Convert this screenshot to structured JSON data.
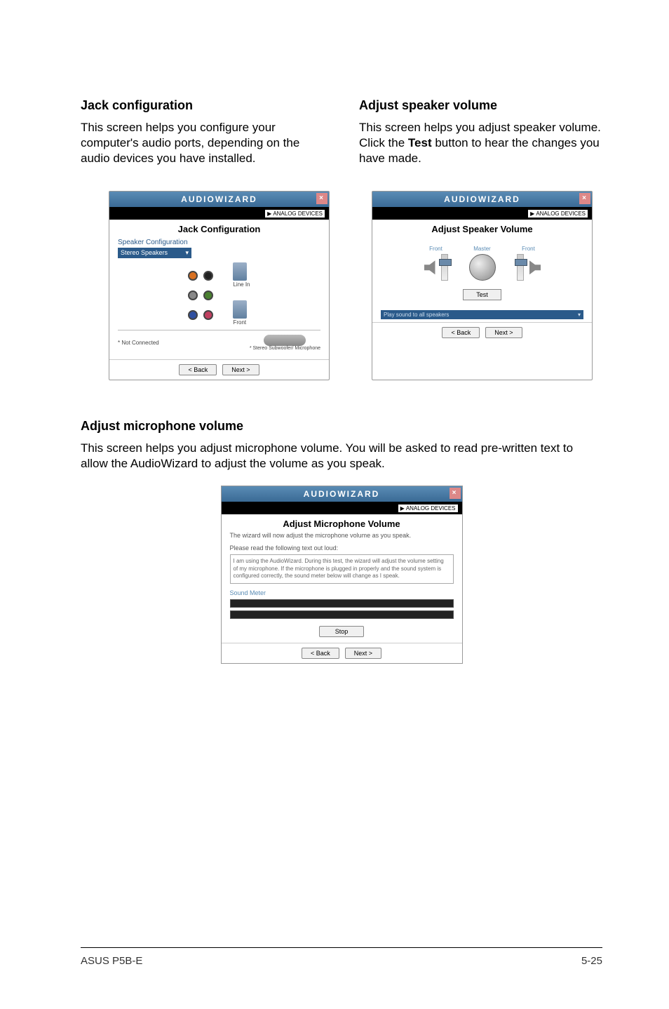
{
  "sections": {
    "jack": {
      "heading": "Jack configuration",
      "para": "This screen helps you configure your computer's audio ports, depending on the audio devices you have installed."
    },
    "speaker": {
      "heading": "Adjust speaker volume",
      "para_pre": "This screen helps you adjust speaker volume. Click the ",
      "para_bold": "Test",
      "para_post": " button to hear the changes you have made."
    },
    "mic": {
      "heading": "Adjust microphone volume",
      "para": "This screen helps you adjust microphone volume. You will be asked to read pre-written text to allow the AudioWizard to adjust the volume as you speak."
    }
  },
  "wizard": {
    "title": "AUDIOWIZARD",
    "logo": "ANALOG DEVICES",
    "back_btn": "< Back",
    "next_btn": "Next >"
  },
  "jack_panel": {
    "title": "Jack Configuration",
    "sub": "Speaker Configuration",
    "dropdown": "Stereo Speakers",
    "line_in": "Line In",
    "front": "Front",
    "not_connected": "* Not Connected",
    "stereo_sw": "* Stereo Subwoofer/ Microphone"
  },
  "speaker_panel": {
    "title": "Adjust Speaker Volume",
    "front": "Front",
    "master": "Master",
    "test_btn": "Test",
    "play_label": "Play sound to all speakers"
  },
  "mic_panel": {
    "title": "Adjust Microphone Volume",
    "intro": "The wizard will now adjust the microphone volume as you speak.",
    "sub": "Please read the following text out loud:",
    "text": "I am using the AudioWizard. During this test, the wizard will adjust the volume setting of my microphone. If the microphone is plugged in properly and the sound system is configured correctly, the sound meter below will change as I speak.",
    "meter": "Sound Meter",
    "stop_btn": "Stop"
  },
  "footer": {
    "left": "ASUS P5B-E",
    "right": "5-25"
  }
}
